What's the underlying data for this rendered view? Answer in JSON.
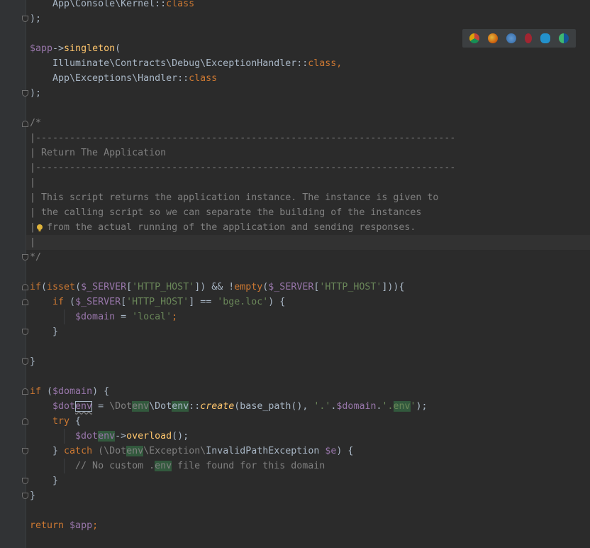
{
  "code": {
    "l1": "    App\\Console\\Kernel::",
    "l1_class": "class",
    "l2": ");",
    "l3_var": "$app",
    "l3_arrow": "->",
    "l3_fn": "singleton",
    "l3_paren": "(",
    "l4_path": "    Illuminate\\Contracts\\Debug\\ExceptionHandler::",
    "l4_class": "class",
    "l4_comma": ",",
    "l5_path": "    App\\Exceptions\\Handler::",
    "l5_class": "class",
    "l6": ");",
    "c1": "/*",
    "c2": "|--------------------------------------------------------------------------",
    "c3": "| Return The Application",
    "c4": "|--------------------------------------------------------------------------",
    "c5": "|",
    "c6": "| This script returns the application instance. The instance is given to",
    "c7": "| the calling script so we can separate the building of the instances",
    "c8_bar": "|",
    "c8_rest": "from the actual running of the application and sending responses.",
    "c9": "|",
    "c10": "*/",
    "if1_kw": "if",
    "if1_a": "(",
    "if1_isset": "isset",
    "if1_b": "(",
    "if1_server1": "$_SERVER",
    "if1_c": "[",
    "if1_host1": "'HTTP_HOST'",
    "if1_d": "]) && !",
    "if1_empty": "empty",
    "if1_e": "(",
    "if1_server2": "$_SERVER",
    "if1_f": "[",
    "if1_host2": "'HTTP_HOST'",
    "if1_g": "])){",
    "if2_kw": "    if",
    "if2_a": " (",
    "if2_server": "$_SERVER",
    "if2_b": "[",
    "if2_host": "'HTTP_HOST'",
    "if2_c": "] == ",
    "if2_val": "'bge.loc'",
    "if2_d": ") {",
    "dom_var": "        $domain",
    "dom_eq": " = ",
    "dom_val": "'local'",
    "dom_semi": ";",
    "close1": "    }",
    "close2": "}",
    "if3_kw": "if",
    "if3_a": " (",
    "if3_var": "$domain",
    "if3_b": ") {",
    "env_var1": "    $dot",
    "env_var2": "env",
    "env_eq": " = ",
    "env_ns1": "\\Dot",
    "env_ns2": "env",
    "env_ns3": "\\Dot",
    "env_ns4": "env",
    "env_sep": "::",
    "env_fn": "create",
    "env_args1": "(base_path(), ",
    "env_s1": "'.'",
    "env_dot": ".",
    "env_dvar": "$domain",
    "env_dot2": ".",
    "env_s2a": "'.",
    "env_s2b": "env",
    "env_s2c": "'",
    "env_end": ");",
    "try_kw": "    try",
    "try_brace": " {",
    "ov_var1": "        $dot",
    "ov_var2": "env",
    "ov_arrow": "->",
    "ov_fn": "overload",
    "ov_end": "();",
    "catch_a": "    } ",
    "catch_kw": "catch",
    "catch_b": " (\\Dot",
    "catch_env": "env",
    "catch_c": "\\Exception\\",
    "catch_cls": "InvalidPathException",
    "catch_var": " $e",
    "catch_d": ") {",
    "cm_a": "        // No custom .",
    "cm_env": "env",
    "cm_b": " file found for this domain",
    "close3": "    }",
    "close4": "}",
    "ret_kw": "return",
    "ret_var": " $app",
    "ret_semi": ";"
  },
  "browser_icons": [
    "chrome-icon",
    "firefox-icon",
    "safari-icon",
    "opera-icon",
    "ie-icon",
    "edge-icon"
  ],
  "colors": {
    "keyword": "#cc7832",
    "variable": "#9876aa",
    "string": "#6a8759",
    "comment": "#808080",
    "function": "#ffc66d",
    "text": "#a9b7c6",
    "background": "#2b2b2b"
  }
}
